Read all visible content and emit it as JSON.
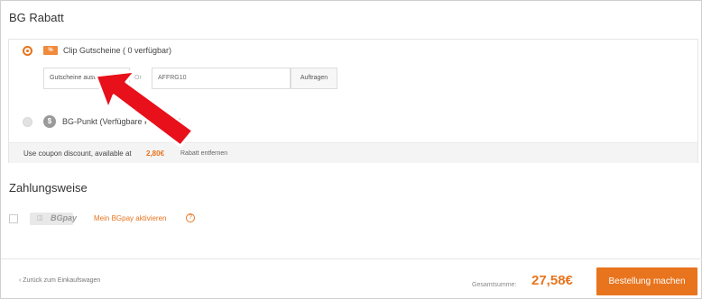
{
  "rabatt": {
    "title": "BG Rabatt",
    "coupon_option_label": "Clip Gutscheine ( 0 verfügbar)",
    "coupon_icon_text": "COUPON",
    "select_value": "Gutscheine auswä...",
    "or_text": "Or",
    "code_value": "AFFRG10",
    "apply_label": "Auftragen",
    "bgpunkt_icon": "$",
    "bgpunkt_label": "BG-Punkt (Verfügbare Punkte: 0)",
    "discount_text": "Use coupon discount, available at",
    "discount_amount": "2,80€",
    "remove_label": "Rabatt entfernen"
  },
  "payment": {
    "title": "Zahlungsweise",
    "bgpay_logo_text": "BGpay",
    "activate_label": "Mein BGpay aktivieren",
    "help_glyph": "?"
  },
  "footer": {
    "back_label": "Zurück zum Einkaufswagen",
    "total_label": "Gesamtsumme:",
    "total_value": "27,58€",
    "order_label": "Bestellung machen"
  },
  "colors": {
    "accent": "#e8741e",
    "arrow": "#e8101a"
  },
  "icons": {
    "coupon": "coupon-icon",
    "bgpunkt": "coin-icon",
    "bgpay": "bgpay-logo-icon",
    "help": "help-icon",
    "back": "chevron-left-icon",
    "annotation": "red-arrow-icon"
  }
}
